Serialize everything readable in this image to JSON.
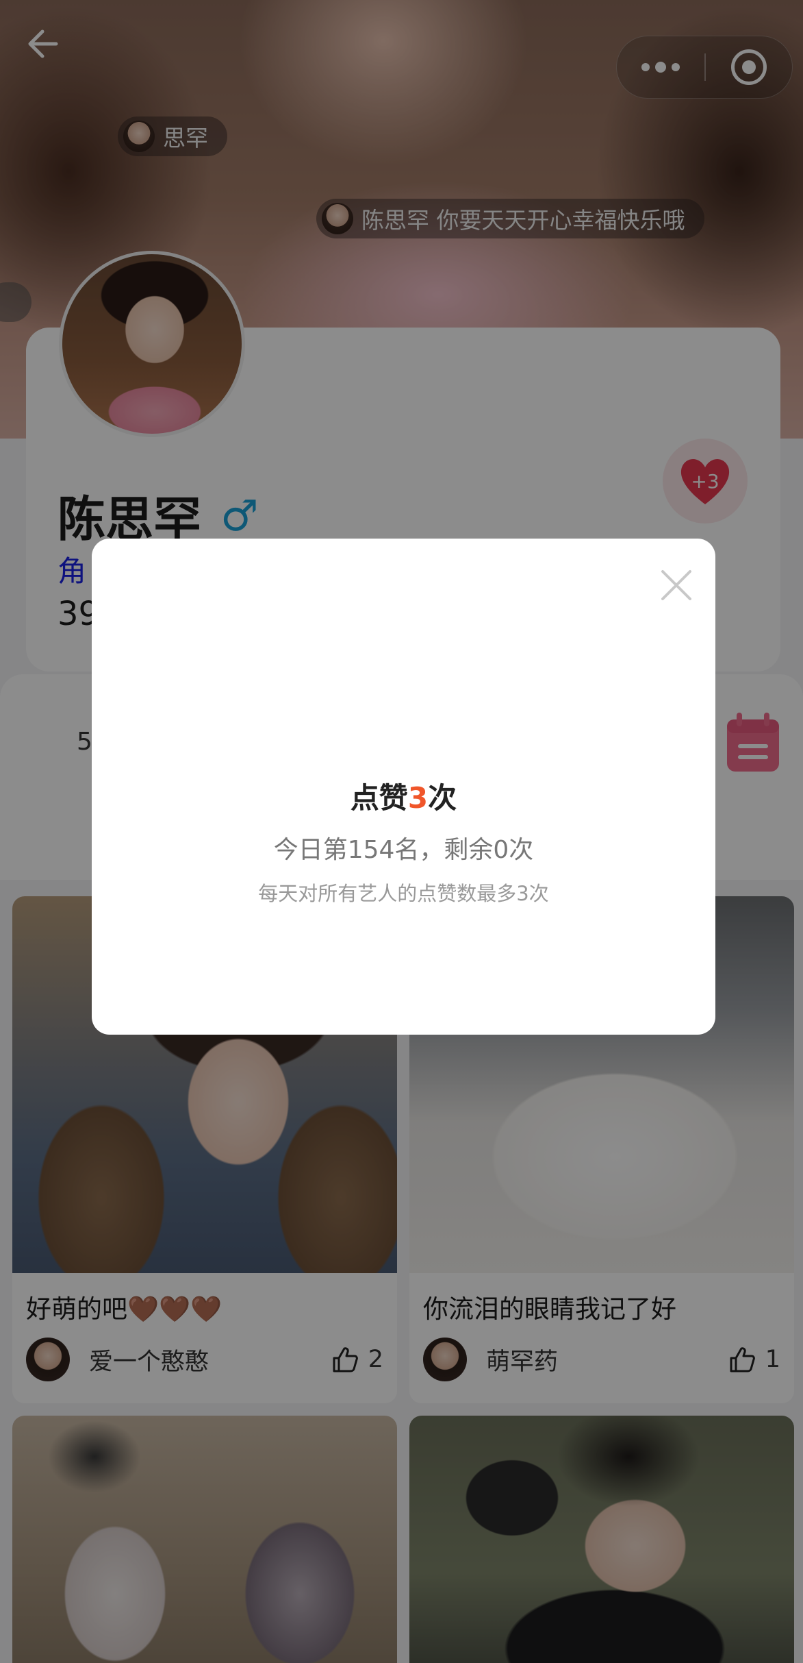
{
  "header": {
    "danmaku": [
      {
        "text": "思罕"
      },
      {
        "text": "陈思罕 你要天天开心幸福快乐哦"
      }
    ]
  },
  "profile": {
    "name": "陈思罕",
    "gender_symbol": "♂",
    "role_text": "角",
    "count_text": "39",
    "like_button_label": "+3"
  },
  "stats": {
    "partial_value": "5"
  },
  "feed": [
    {
      "caption": "好萌的吧🤎🤎🤎",
      "author": "爱一个憨憨",
      "likes": "2"
    },
    {
      "caption": "你流泪的眼睛我记了好",
      "author": "萌罕药",
      "likes": "1"
    },
    {
      "caption": "",
      "author": "",
      "likes": ""
    },
    {
      "caption": "",
      "author": "",
      "likes": ""
    }
  ],
  "modal": {
    "title_prefix": "点赞",
    "title_number": "3",
    "title_suffix": "次",
    "subtitle": "今日第154名，剩余0次",
    "note": "每天对所有艺人的点赞数最多3次"
  },
  "colors": {
    "accent_orange": "#f0562a",
    "heart_red": "#e8384f",
    "calendar_pink": "#f06c8c",
    "gender_blue": "#1ba1d7",
    "role_blue": "#1a22e6"
  },
  "icons": {
    "back": "back-arrow-icon",
    "more": "more-dots-icon",
    "target": "target-icon",
    "heart": "heart-icon",
    "calendar": "calendar-icon",
    "thumb": "thumbs-up-icon",
    "close": "close-icon"
  }
}
